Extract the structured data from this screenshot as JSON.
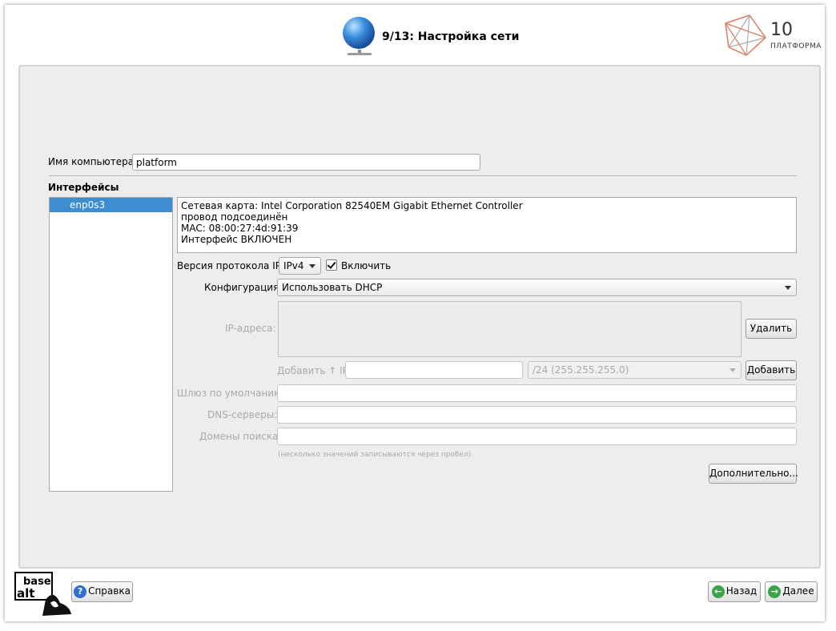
{
  "header": {
    "title": "9/13: Настройка сети",
    "logo_number": "10",
    "logo_text": "ПЛАТФОРМА"
  },
  "form": {
    "hostname_label": "Имя компьютера:",
    "hostname_value": "platform",
    "interfaces_label": "Интерфейсы",
    "interfaces": [
      {
        "name": "enp0s3",
        "selected": true
      }
    ],
    "info_lines": [
      "Сетевая карта: Intel Corporation 82540EM Gigabit Ethernet Controller",
      "провод подсоединён",
      "MAC: 08:00:27:4d:91:39",
      "Интерфейс ВКЛЮЧЕН"
    ],
    "ip_version_label": "Версия протокола IP:",
    "ip_version_value": "IPv4",
    "enable_label": "Включить",
    "enable_checked": true,
    "config_label": "Конфигурация:",
    "config_value": "Использовать DHCP",
    "ip_addresses_label": "IP-адреса:",
    "delete_button": "Удалить",
    "add_ip_label": "Добавить ↑ IP:",
    "add_ip_value": "",
    "mask_value": "/24 (255.255.255.0)",
    "add_button": "Добавить",
    "gateway_label": "Шлюз по умолчанию:",
    "gateway_value": "",
    "dns_label": "DNS-серверы:",
    "dns_value": "",
    "domains_label": "Домены поиска:",
    "domains_value": "",
    "hint": "(несколько значений записываются через пробел)",
    "advanced_button": "Дополнительно..."
  },
  "footer": {
    "logo_top": "base",
    "logo_bottom": "alt",
    "help_button": "Справка",
    "back_button": "Назад",
    "next_button": "Далее"
  },
  "colors": {
    "selection": "#3d8ed0",
    "panel_bg": "#ededed",
    "disabled_text": "#a9a9a9"
  }
}
